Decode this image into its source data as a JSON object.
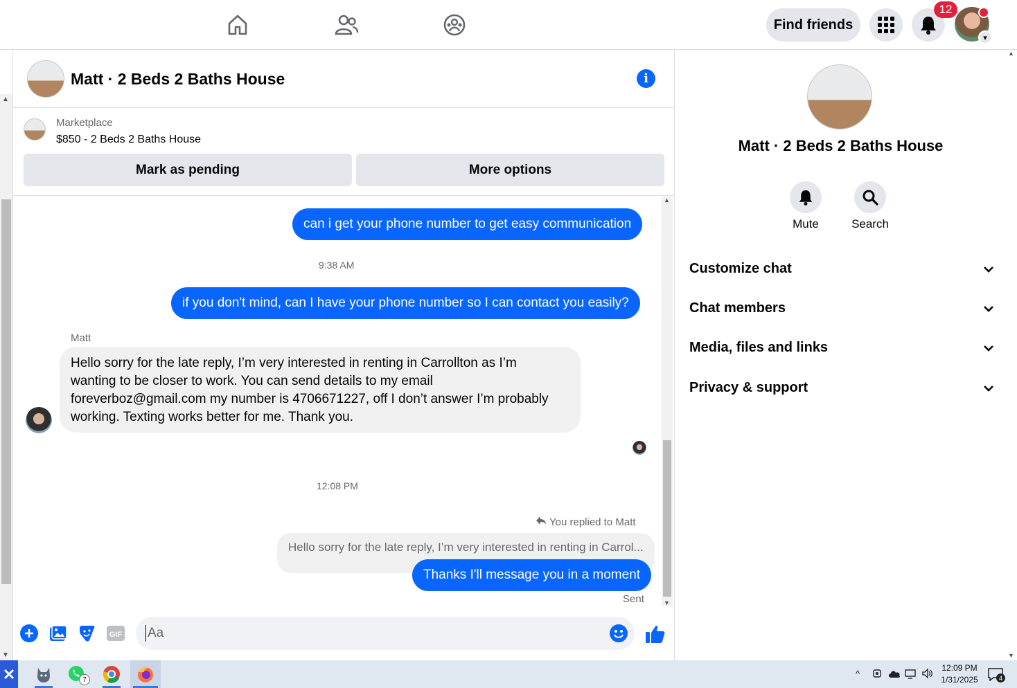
{
  "topnav": {
    "find_friends": "Find friends",
    "notif_count": "12"
  },
  "chat": {
    "title": "Matt · 2 Beds 2 Baths House",
    "marketplace_label": "Marketplace",
    "item_title": "$850 - 2 Beds 2 Baths House",
    "mark_pending": "Mark as pending",
    "more_options": "More options",
    "messages": {
      "m1": "can i get your phone number to get easy communication",
      "t1": "9:38 AM",
      "m2": "if you don't mind,  can I have your phone number so I can contact you easily?",
      "sender": "Matt",
      "in_lines": [
        "Hello sorry for the late reply, I’m very interested in renting in Carrollton as I’m",
        "wanting to be closer to work. You can send details to my email",
        "foreverboz@gmail.com my number is 4706671227, off I don’t answer I’m probably",
        "working. Texting works better for me. Thank you."
      ],
      "t2": "12:08 PM",
      "replied_to": "You replied to Matt",
      "quote": "Hello sorry for the late reply, I’m very interested in renting in Carrol...",
      "m3": "Thanks I'll message you in a moment",
      "status": "Sent"
    },
    "composer_placeholder": "Aa"
  },
  "sidebar": {
    "name": "Matt · 2 Beds 2 Baths House",
    "mute": "Mute",
    "search": "Search",
    "sections": [
      "Customize chat",
      "Chat members",
      "Media, files and links",
      "Privacy & support"
    ]
  },
  "taskbar": {
    "whatsapp_count": "7",
    "time": "12:09 PM",
    "date": "1/31/2025",
    "notif_count": "4"
  },
  "colors": {
    "accent": "#0866ff",
    "badge": "#e41e3f",
    "bubble_in": "#f0f0f0"
  }
}
